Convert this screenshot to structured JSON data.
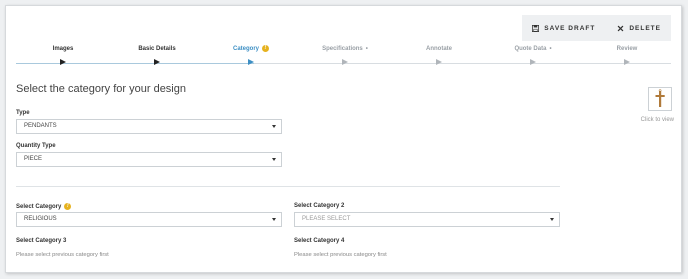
{
  "toolbar": {
    "save_draft": "SAVE DRAFT",
    "delete": "DELETE"
  },
  "steps": [
    {
      "label": "Images",
      "state": "done",
      "suffix": ""
    },
    {
      "label": "Basic Details",
      "state": "done",
      "suffix": ""
    },
    {
      "label": "Category",
      "state": "active",
      "suffix": "info"
    },
    {
      "label": "Specifications",
      "state": "pending",
      "suffix": "•"
    },
    {
      "label": "Annotate",
      "state": "pending",
      "suffix": ""
    },
    {
      "label": "Quote Data",
      "state": "pending",
      "suffix": "•"
    },
    {
      "label": "Review",
      "state": "pending",
      "suffix": ""
    }
  ],
  "main": {
    "heading": "Select the category for your design",
    "preview_caption": "Click to view"
  },
  "fields": {
    "type": {
      "label": "Type",
      "value": "PENDANTS"
    },
    "quantity_type": {
      "label": "Quantity Type",
      "value": "PIECE"
    },
    "category1": {
      "label": "Select Category",
      "value": "RELIGIOUS"
    },
    "category2": {
      "label": "Select Category 2",
      "value": "PLEASE SELECT"
    },
    "category3": {
      "label": "Select Category 3",
      "helper": "Please select previous category first"
    },
    "category4": {
      "label": "Select Category 4",
      "helper": "Please select previous category first"
    }
  },
  "colors": {
    "accent": "#3d8fc4",
    "info": "#e6b21f"
  }
}
